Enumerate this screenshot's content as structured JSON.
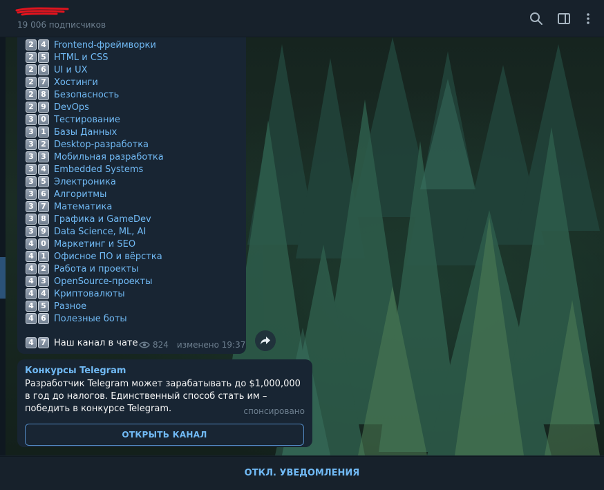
{
  "header": {
    "subscribers": "19 006 подписчиков",
    "icons": [
      "search-icon",
      "sidebar-toggle-icon",
      "more-vertical-icon"
    ]
  },
  "message": {
    "rows": [
      {
        "num": [
          "2",
          "4"
        ],
        "label": "Frontend-фреймворки"
      },
      {
        "num": [
          "2",
          "5"
        ],
        "label": "HTML и CSS"
      },
      {
        "num": [
          "2",
          "6"
        ],
        "label": "UI и UX"
      },
      {
        "num": [
          "2",
          "7"
        ],
        "label": "Хостинги"
      },
      {
        "num": [
          "2",
          "8"
        ],
        "label": "Безопасность"
      },
      {
        "num": [
          "2",
          "9"
        ],
        "label": "DevOps"
      },
      {
        "num": [
          "3",
          "0"
        ],
        "label": "Тестирование"
      },
      {
        "num": [
          "3",
          "1"
        ],
        "label": "Базы Данных"
      },
      {
        "num": [
          "3",
          "2"
        ],
        "label": "Desktop-разработка"
      },
      {
        "num": [
          "3",
          "3"
        ],
        "label": "Мобильная разработка"
      },
      {
        "num": [
          "3",
          "4"
        ],
        "label": "Embedded Systems"
      },
      {
        "num": [
          "3",
          "5"
        ],
        "label": "Электроника"
      },
      {
        "num": [
          "3",
          "6"
        ],
        "label": "Алгоритмы"
      },
      {
        "num": [
          "3",
          "7"
        ],
        "label": "Математика"
      },
      {
        "num": [
          "3",
          "8"
        ],
        "label": "Графика и GameDev"
      },
      {
        "num": [
          "3",
          "9"
        ],
        "label": "Data Science, ML, AI"
      },
      {
        "num": [
          "4",
          "0"
        ],
        "label": "Маркетинг и SEO"
      },
      {
        "num": [
          "4",
          "1"
        ],
        "label": "Офисное ПО и вёрстка"
      },
      {
        "num": [
          "4",
          "2"
        ],
        "label": "Работа и проекты"
      },
      {
        "num": [
          "4",
          "3"
        ],
        "label": "OpenSource-проекты"
      },
      {
        "num": [
          "4",
          "4"
        ],
        "label": "Криптовалюты"
      },
      {
        "num": [
          "4",
          "5"
        ],
        "label": "Разное"
      },
      {
        "num": [
          "4",
          "6"
        ],
        "label": "Полезные боты"
      }
    ],
    "last_row": {
      "num": [
        "4",
        "7"
      ],
      "label": "Наш канал в чате"
    },
    "views": "824",
    "edited": "изменено 19:37"
  },
  "sponsored": {
    "title": "Конкурсы Telegram",
    "text": "Разработчик Telegram может зарабатывать до $1,000,000 в год до налогов. Единственный способ стать им – победить в конкурсе Telegram.",
    "label": "спонсировано",
    "button": "ОТКРЫТЬ КАНАЛ"
  },
  "bottom": {
    "unmute": "ОТКЛ. УВЕДОМЛЕНИЯ"
  },
  "colors": {
    "background": "#17212b",
    "bubble": "#182533",
    "link": "#71baf5",
    "muted": "#6d7f8f"
  }
}
